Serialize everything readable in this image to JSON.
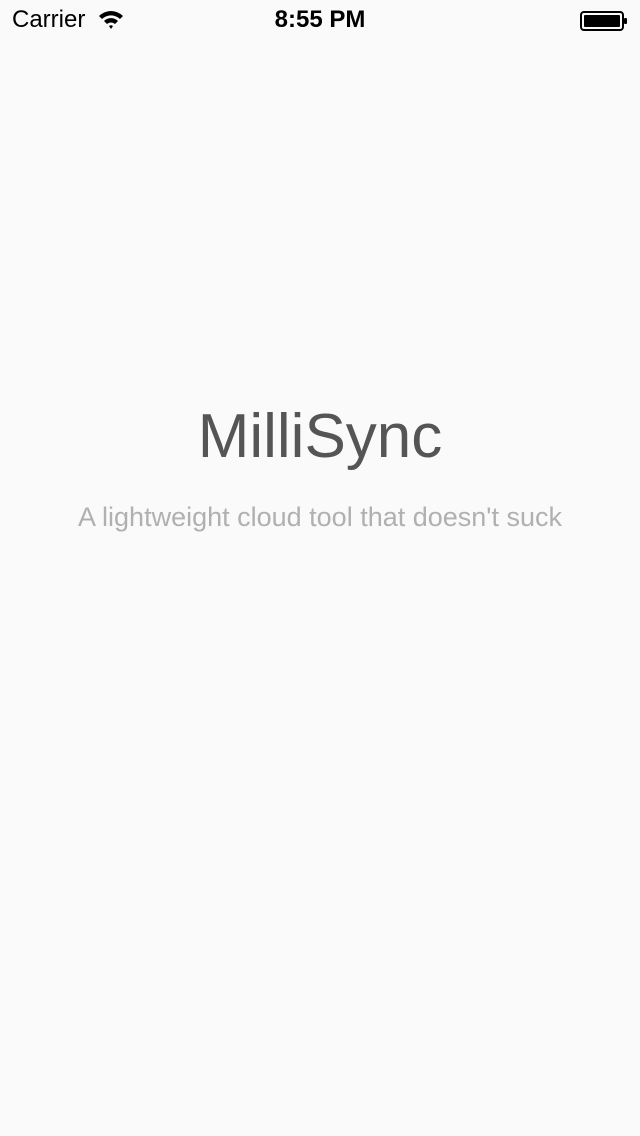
{
  "status_bar": {
    "carrier": "Carrier",
    "time": "8:55 PM",
    "wifi_icon": "wifi-icon",
    "battery_icon": "battery-icon",
    "battery_level": 1.0
  },
  "main": {
    "title": "MilliSync",
    "subtitle": "A lightweight cloud tool that doesn't suck"
  },
  "colors": {
    "background": "#fafafa",
    "title": "#555555",
    "subtitle": "#b0b0b0"
  }
}
